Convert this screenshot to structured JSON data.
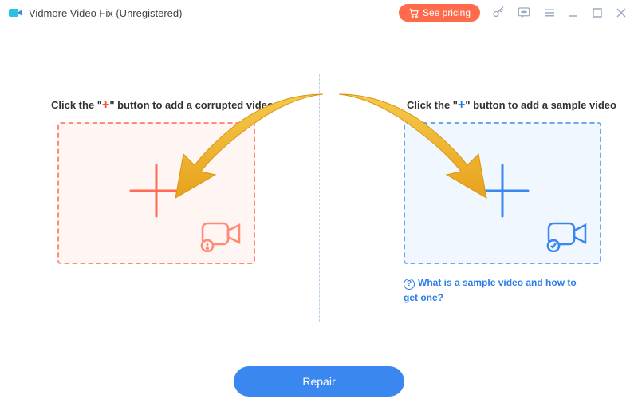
{
  "titlebar": {
    "title": "Vidmore Video Fix (Unregistered)",
    "see_pricing": "See pricing"
  },
  "left_panel": {
    "title_pre": "Click the \"",
    "title_mid": "+",
    "title_post": "\" button to add a corrupted video"
  },
  "right_panel": {
    "title_pre": "Click the \"",
    "title_mid": "+",
    "title_post": "\" button to add a sample video",
    "help_question": "?",
    "help_text": "What is a sample video and how to get one?"
  },
  "footer": {
    "repair": "Repair"
  },
  "colors": {
    "accent_red": "#ff4e3a",
    "accent_blue": "#2b7de9",
    "arrow": "#f1b92b"
  }
}
